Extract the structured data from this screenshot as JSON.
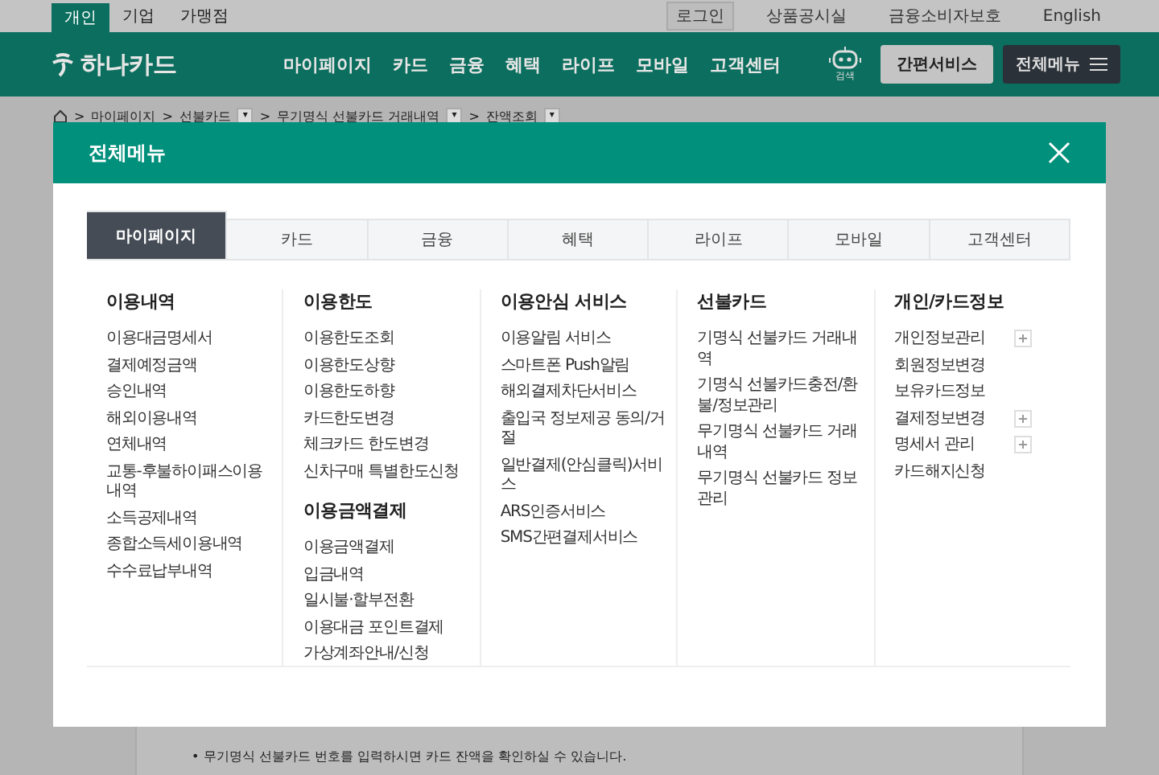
{
  "top_tabs": [
    {
      "label": "개인",
      "selected": true
    },
    {
      "label": "기업",
      "selected": false
    },
    {
      "label": "가맹점",
      "selected": false
    }
  ],
  "top_links": [
    {
      "label": "로그인",
      "boxed": true
    },
    {
      "label": "상품공시실",
      "boxed": false
    },
    {
      "label": "금융소비자보호",
      "boxed": false
    },
    {
      "label": "English",
      "boxed": false
    }
  ],
  "logo": "하나카드",
  "nav": [
    "마이페이지",
    "카드",
    "금융",
    "혜택",
    "라이프",
    "모바일",
    "고객센터"
  ],
  "search_label": "검색",
  "quick_button": "간편서비스",
  "menu_button": "전체메뉴",
  "breadcrumb": [
    {
      "separator": ">",
      "label": "마이페이지"
    },
    {
      "separator": ">",
      "label": "선불카드",
      "dropdown": "▾"
    },
    {
      "separator": ">",
      "label": "무기명식 선불카드 거래내역",
      "dropdown": "▾"
    },
    {
      "separator": ">",
      "label": "잔액조회",
      "dropdown": "▾"
    }
  ],
  "modal": {
    "title": "전체메뉴",
    "tabs": [
      {
        "label": "마이페이지",
        "selected": true
      },
      {
        "label": "카드",
        "selected": false
      },
      {
        "label": "금융",
        "selected": false
      },
      {
        "label": "혜택",
        "selected": false
      },
      {
        "label": "라이프",
        "selected": false
      },
      {
        "label": "모바일",
        "selected": false
      },
      {
        "label": "고객센터",
        "selected": false
      }
    ],
    "columns": [
      {
        "sections": [
          {
            "title": "이용내역",
            "items": [
              {
                "label": "이용대금명세서",
                "expandable": false
              },
              {
                "label": "결제예정금액",
                "expandable": false
              },
              {
                "label": "승인내역",
                "expandable": false
              },
              {
                "label": "해외이용내역",
                "expandable": false
              },
              {
                "label": "연체내역",
                "expandable": false
              },
              {
                "label": "교통-후불하이패스이용내역",
                "expandable": false
              },
              {
                "label": "소득공제내역",
                "expandable": false
              },
              {
                "label": "종합소득세이용내역",
                "expandable": false
              },
              {
                "label": "수수료납부내역",
                "expandable": false
              }
            ]
          }
        ]
      },
      {
        "sections": [
          {
            "title": "이용한도",
            "items": [
              {
                "label": "이용한도조회",
                "expandable": false
              },
              {
                "label": "이용한도상향",
                "expandable": false
              },
              {
                "label": "이용한도하향",
                "expandable": false
              },
              {
                "label": "카드한도변경",
                "expandable": false
              },
              {
                "label": "체크카드 한도변경",
                "expandable": false
              },
              {
                "label": "신차구매 특별한도신청",
                "expandable": false
              }
            ]
          },
          {
            "title": "이용금액결제",
            "items": [
              {
                "label": "이용금액결제",
                "expandable": false
              },
              {
                "label": "입금내역",
                "expandable": false
              },
              {
                "label": "일시불·할부전환",
                "expandable": false
              },
              {
                "label": "이용대금 포인트결제",
                "expandable": false
              },
              {
                "label": "가상계좌안내/신청",
                "expandable": false
              }
            ]
          }
        ]
      },
      {
        "sections": [
          {
            "title": "이용안심 서비스",
            "items": [
              {
                "label": "이용알림 서비스",
                "expandable": false
              },
              {
                "label": "스마트폰 Push알림",
                "expandable": false
              },
              {
                "label": "해외결제차단서비스",
                "expandable": false
              },
              {
                "label": "출입국 정보제공 동의/거절",
                "expandable": false
              },
              {
                "label": "일반결제(안심클릭)서비스",
                "expandable": false
              },
              {
                "label": "ARS인증서비스",
                "expandable": false
              },
              {
                "label": "SMS간편결제서비스",
                "expandable": false
              }
            ]
          }
        ]
      },
      {
        "sections": [
          {
            "title": "선불카드",
            "items": [
              {
                "label": "기명식 선불카드 거래내역",
                "expandable": false
              },
              {
                "label": "기명식 선불카드충전/환불/정보관리",
                "expandable": false
              },
              {
                "label": "무기명식 선불카드 거래내역",
                "expandable": false
              },
              {
                "label": "무기명식 선불카드 정보관리",
                "expandable": false
              }
            ]
          }
        ]
      },
      {
        "sections": [
          {
            "title": "개인/카드정보",
            "items": [
              {
                "label": "개인정보관리",
                "expandable": true
              },
              {
                "label": "회원정보변경",
                "expandable": false
              },
              {
                "label": "보유카드정보",
                "expandable": false
              },
              {
                "label": "결제정보변경",
                "expandable": true
              },
              {
                "label": "명세서 관리",
                "expandable": true
              },
              {
                "label": "카드해지신청",
                "expandable": false
              }
            ]
          }
        ]
      }
    ]
  },
  "notice": "• 무기명식 선불카드 번호를 입력하시면 카드 잔액을 확인하실 수 있습니다."
}
